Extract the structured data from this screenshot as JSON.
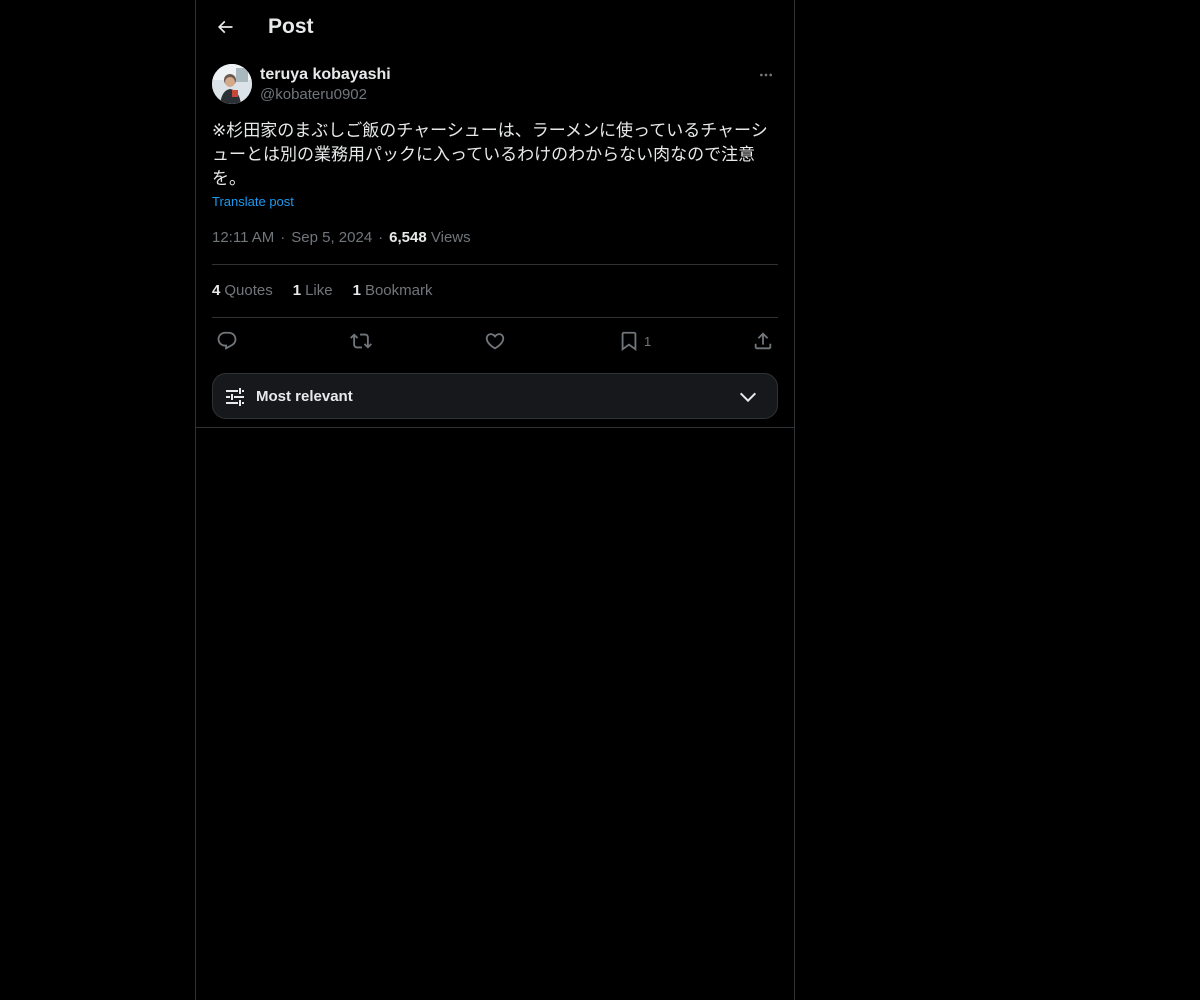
{
  "header": {
    "title": "Post",
    "back_icon": "arrow-left-icon"
  },
  "post": {
    "author_name": "teruya kobayashi",
    "author_handle": "@kobateru0902",
    "text": "※杉田家のまぶしご飯のチャーシューは、ラーメンに使っているチャーシューとは別の業務用パックに入っているわけのわからない肉なので注意を。",
    "translate_label": "Translate post",
    "time": "12:11 AM",
    "date": "Sep 5, 2024",
    "views_count": "6,548",
    "views_label": "Views",
    "separator": "·"
  },
  "stats": {
    "quotes_count": "4",
    "quotes_label": "Quotes",
    "likes_count": "1",
    "likes_label": "Like",
    "bookmarks_count": "1",
    "bookmarks_label": "Bookmark"
  },
  "actions": {
    "reply_icon": "reply-icon",
    "repost_icon": "repost-icon",
    "like_icon": "heart-icon",
    "bookmark_icon": "bookmark-icon",
    "bookmark_count": "1",
    "share_icon": "share-icon"
  },
  "sort": {
    "label": "Most relevant",
    "icon": "sliders-icon",
    "chevron": "chevron-down-icon"
  },
  "colors": {
    "background": "#000000",
    "text_primary": "#e7e9ea",
    "text_secondary": "#71767b",
    "link": "#1d9bf0",
    "border": "#2f3336"
  }
}
